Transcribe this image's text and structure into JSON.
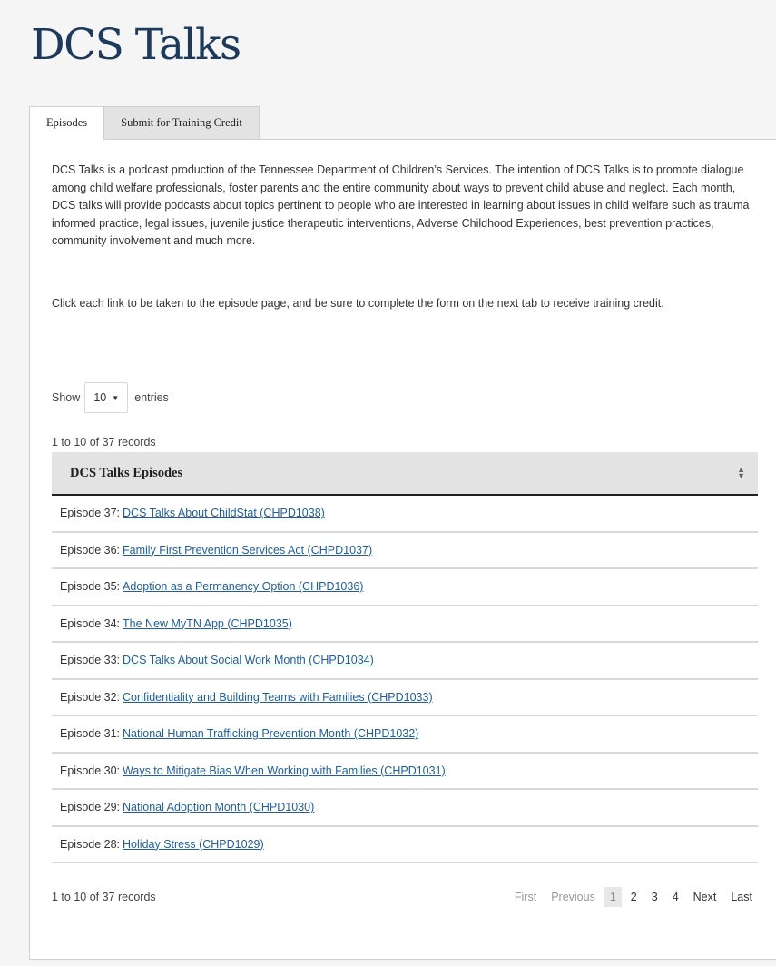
{
  "page": {
    "title": "DCS Talks"
  },
  "tabs": [
    {
      "label": "Episodes",
      "active": true
    },
    {
      "label": "Submit for Training Credit",
      "active": false
    }
  ],
  "intro": {
    "paragraph1": "DCS Talks is a podcast production of the Tennessee Department of Children’s Services. The intention of DCS Talks is to promote dialogue among child welfare professionals, foster parents and the entire community about ways to prevent child abuse and neglect. Each month, DCS talks will provide podcasts about topics pertinent to people who are interested in learning about issues in child welfare such as trauma informed practice, legal issues, juvenile justice therapeutic interventions, Adverse Childhood Experiences, best prevention practices, community involvement and much more.",
    "paragraph2": "Click each link to be taken to the episode page, and be sure to complete the form on the next tab to receive training credit."
  },
  "length_control": {
    "show_label": "Show",
    "selected": "10",
    "entries_label": "entries"
  },
  "records_info": "1 to 10 of 37 records",
  "table": {
    "header": "DCS Talks Episodes",
    "rows": [
      {
        "prefix": "Episode 37:",
        "link": "DCS Talks About ChildStat (CHPD1038)"
      },
      {
        "prefix": "Episode 36:",
        "link": "Family First Prevention Services Act (CHPD1037)"
      },
      {
        "prefix": "Episode 35:",
        "link": "Adoption as a Permanency Option (CHPD1036)"
      },
      {
        "prefix": "Episode 34:",
        "link": "The New MyTN App (CHPD1035)"
      },
      {
        "prefix": "Episode 33:",
        "link": "DCS Talks About Social Work Month (CHPD1034)"
      },
      {
        "prefix": "Episode 32:",
        "link": "Confidentiality and Building Teams with Families (CHPD1033)"
      },
      {
        "prefix": "Episode 31:",
        "link": "National Human Trafficking Prevention Month (CHPD1032)"
      },
      {
        "prefix": "Episode 30:",
        "link": "Ways to Mitigate Bias When Working with Families (CHPD1031)"
      },
      {
        "prefix": "Episode 29:",
        "link": "National Adoption Month (CHPD1030)"
      },
      {
        "prefix": "Episode 28:",
        "link": "Holiday Stress (CHPD1029)"
      }
    ]
  },
  "pagination": {
    "first": "First",
    "previous": "Previous",
    "pages": [
      "1",
      "2",
      "3",
      "4"
    ],
    "current": "1",
    "next": "Next",
    "last": "Last"
  },
  "icons": {
    "select_caret": "caret-down-icon",
    "sort": "sort-icon"
  },
  "colors": {
    "title": "#1e3a5a",
    "link": "#1f5f9c",
    "header_bg": "#e3e3e3"
  }
}
